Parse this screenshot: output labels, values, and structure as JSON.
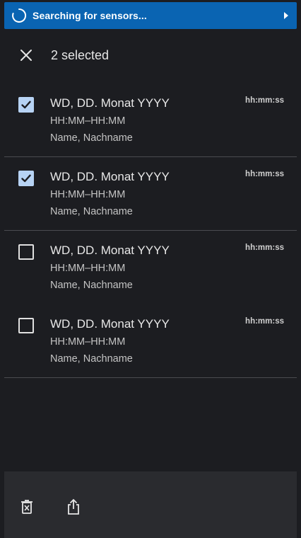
{
  "banner": {
    "text": "Searching for sensors...",
    "spinner_icon": "spinner-icon",
    "arrow_icon": "chevron-right-icon",
    "color": "#0a64b2"
  },
  "header": {
    "close_icon": "close-icon",
    "selected_text": "2 selected"
  },
  "items": [
    {
      "checked": true,
      "title": "WD, DD. Monat YYYY",
      "time_range": "HH:MM–HH:MM",
      "name": "Name, Nachname",
      "duration": "hh:mm:ss"
    },
    {
      "checked": true,
      "title": "WD, DD. Monat YYYY",
      "time_range": "HH:MM–HH:MM",
      "name": "Name, Nachname",
      "duration": "hh:mm:ss"
    },
    {
      "checked": false,
      "title": "WD, DD. Monat YYYY",
      "time_range": "HH:MM–HH:MM",
      "name": "Name, Nachname",
      "duration": "hh:mm:ss"
    },
    {
      "checked": false,
      "title": "WD, DD. Monat YYYY",
      "time_range": "HH:MM–HH:MM",
      "name": "Name, Nachname",
      "duration": "hh:mm:ss"
    }
  ],
  "bottom_bar": {
    "delete_icon": "delete-icon",
    "share_icon": "share-icon"
  },
  "colors": {
    "background": "#1c1d21",
    "bottom_bar": "#2a2b2f",
    "checkbox_checked": "#b7d3f4",
    "divider": "#4a4b50"
  }
}
